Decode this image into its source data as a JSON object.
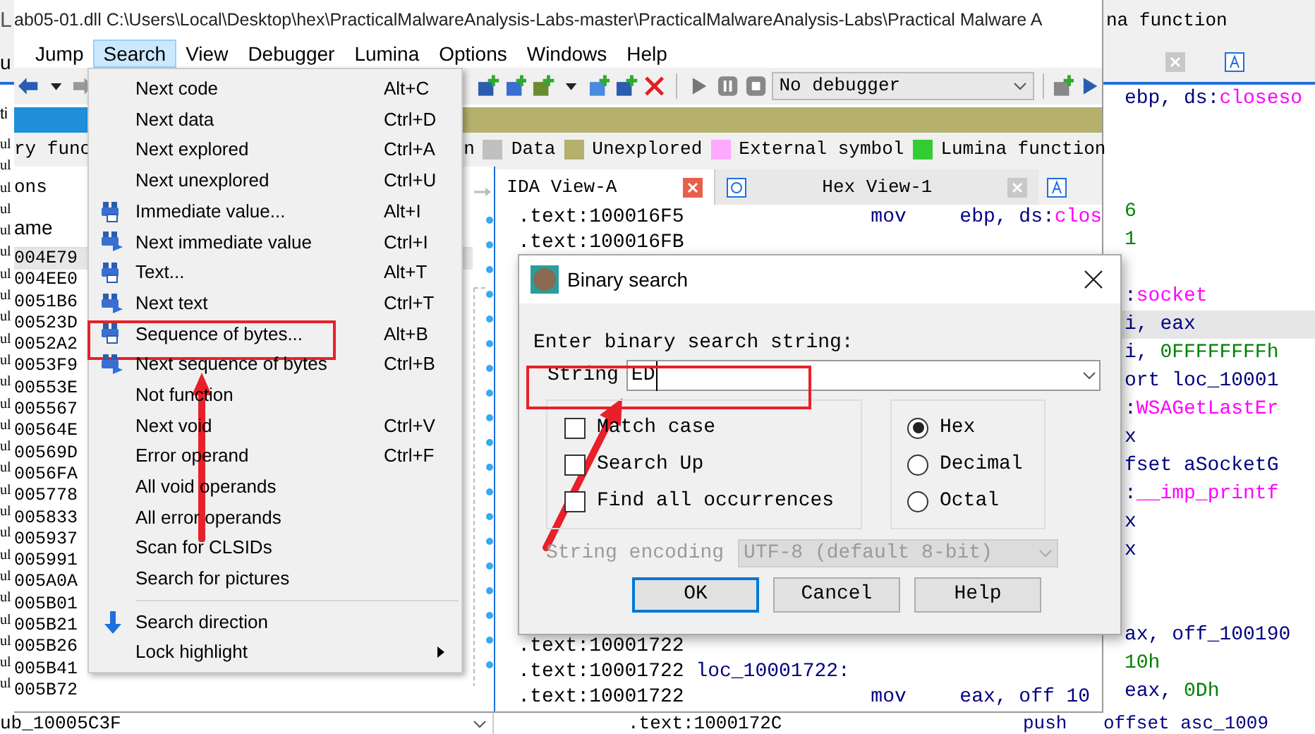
{
  "back_window": {
    "header_fragment": "na function",
    "left_edge": [
      "L",
      "u",
      "ti"
    ],
    "left_edge_rows": [
      "ul",
      "ul",
      "ul",
      "ul",
      "ul",
      "ul",
      "ul",
      "ul",
      "ul",
      "ul",
      "ul",
      "ul",
      "ul",
      "ul",
      "ul",
      "ul",
      "ul",
      "ul",
      "ul",
      "ul",
      "ul",
      "ul",
      "ul",
      "ul",
      "ul",
      "ul"
    ],
    "code_lines": [
      {
        "kind": "code",
        "highlighted": false,
        "segments": [
          {
            "kind": "text",
            "text": "ebp, ds:"
          },
          {
            "kind": "name",
            "text": "closeso"
          }
        ]
      },
      {
        "kind": "blank"
      },
      {
        "kind": "blank"
      },
      {
        "kind": "blank"
      },
      {
        "kind": "code",
        "highlighted": false,
        "segments": [
          {
            "kind": "number",
            "text": "6"
          }
        ]
      },
      {
        "kind": "code",
        "highlighted": false,
        "segments": [
          {
            "kind": "number",
            "text": "1"
          }
        ]
      },
      {
        "kind": "blank"
      },
      {
        "kind": "code",
        "highlighted": false,
        "segments": [
          {
            "kind": "text",
            "text": ":"
          },
          {
            "kind": "name",
            "text": "socket"
          }
        ]
      },
      {
        "kind": "code",
        "highlighted": true,
        "segments": [
          {
            "kind": "text",
            "text": "i, eax"
          }
        ]
      },
      {
        "kind": "code",
        "highlighted": false,
        "segments": [
          {
            "kind": "text",
            "text": "i, "
          },
          {
            "kind": "number",
            "text": "0FFFFFFFFh"
          }
        ]
      },
      {
        "kind": "code",
        "highlighted": false,
        "segments": [
          {
            "kind": "text",
            "text": "ort loc_10001"
          }
        ]
      },
      {
        "kind": "code",
        "highlighted": false,
        "segments": [
          {
            "kind": "text",
            "text": ":"
          },
          {
            "kind": "name",
            "text": "WSAGetLastEr"
          }
        ]
      },
      {
        "kind": "code",
        "highlighted": false,
        "segments": [
          {
            "kind": "text",
            "text": "x"
          }
        ]
      },
      {
        "kind": "code",
        "highlighted": false,
        "segments": [
          {
            "kind": "text",
            "text": "fset aSocketG"
          }
        ]
      },
      {
        "kind": "code",
        "highlighted": false,
        "segments": [
          {
            "kind": "text",
            "text": ":"
          },
          {
            "kind": "name",
            "text": "__imp_printf"
          }
        ]
      },
      {
        "kind": "code",
        "highlighted": false,
        "segments": [
          {
            "kind": "text",
            "text": "x"
          }
        ]
      },
      {
        "kind": "code",
        "highlighted": false,
        "segments": [
          {
            "kind": "text",
            "text": "x"
          }
        ]
      },
      {
        "kind": "blank"
      },
      {
        "kind": "blank"
      },
      {
        "kind": "code",
        "highlighted": false,
        "segments": [
          {
            "kind": "text",
            "text": "ax, off_100190"
          }
        ]
      },
      {
        "kind": "code",
        "highlighted": false,
        "segments": [
          {
            "kind": "number",
            "text": "10h"
          }
        ]
      },
      {
        "kind": "code",
        "highlighted": false,
        "segments": [
          {
            "kind": "text",
            "text": "eax, "
          },
          {
            "kind": "number",
            "text": "0Dh"
          }
        ]
      }
    ],
    "bottom_row": {
      "function_box": "ub_10005C3F",
      "address": ".text:1000172C",
      "mnemonic": "push",
      "operand": "offset asc_1009"
    }
  },
  "window": {
    "title": "ab05-01.dll C:\\Users\\Local\\Desktop\\hex\\PracticalMalwareAnalysis-Labs-master\\PracticalMalwareAnalysis-Labs\\Practical Malware A"
  },
  "menu_bar": [
    {
      "label": "Jump",
      "selected": false
    },
    {
      "label": "Search",
      "selected": true
    },
    {
      "label": "View",
      "selected": false
    },
    {
      "label": "Debugger",
      "selected": false
    },
    {
      "label": "Lumina",
      "selected": false
    },
    {
      "label": "Options",
      "selected": false
    },
    {
      "label": "Windows",
      "selected": false
    },
    {
      "label": "Help",
      "selected": false
    }
  ],
  "toolbar": {
    "debugger_select": "No debugger"
  },
  "legend": {
    "left_fragment": "ry func",
    "right_fragment": "n",
    "items": [
      {
        "label": "Data",
        "color": "#c0c0c0"
      },
      {
        "label": "Unexplored",
        "color": "#b5b06c"
      },
      {
        "label": "External symbol",
        "color": "#ffa8ff"
      },
      {
        "label": "Lumina function",
        "color": "#33cc33"
      }
    ]
  },
  "functions_panel": {
    "title": "ons",
    "column": "ame",
    "rows": [
      {
        "name": "004E79",
        "selected": true
      },
      {
        "name": "004EE0",
        "selected": false
      },
      {
        "name": "0051B6",
        "selected": false
      },
      {
        "name": "00523D",
        "selected": false
      },
      {
        "name": "0052A2",
        "selected": false
      },
      {
        "name": "0053F9",
        "selected": false
      },
      {
        "name": "00553E",
        "selected": false
      },
      {
        "name": "005567",
        "selected": false
      },
      {
        "name": "00564E",
        "selected": false
      },
      {
        "name": "00569D",
        "selected": false
      },
      {
        "name": "0056FA",
        "selected": false
      },
      {
        "name": "005778",
        "selected": false
      },
      {
        "name": "005833",
        "selected": false
      },
      {
        "name": "005937",
        "selected": false
      },
      {
        "name": "005991",
        "selected": false
      },
      {
        "name": "005A0A",
        "selected": false
      },
      {
        "name": "005B01",
        "selected": false
      },
      {
        "name": "005B21",
        "selected": false
      },
      {
        "name": "005B26",
        "selected": false
      },
      {
        "name": "005B41",
        "selected": false
      },
      {
        "name": "005B72",
        "selected": false
      }
    ]
  },
  "view_tabs": [
    {
      "label": "IDA View-A",
      "selected": true
    },
    {
      "label": "Hex View-1",
      "selected": false
    }
  ],
  "code_top": [
    {
      "address": ".text:100016F5",
      "mnemonic": "mov",
      "operand": [
        {
          "kind": "text",
          "text": "ebp, ds:"
        },
        {
          "kind": "name",
          "text": "clos"
        }
      ]
    },
    {
      "address": ".text:100016FB"
    }
  ],
  "code_bottom": [
    {
      "address": ".text:10001722"
    },
    {
      "address": ".text:10001722",
      "label": "loc_10001722:"
    },
    {
      "address": ".text:10001722",
      "mnemonic": "mov",
      "operand": [
        {
          "kind": "text",
          "text": "eax, off 10"
        }
      ]
    }
  ],
  "search_menu": [
    {
      "kind": "plain",
      "label": "Next code",
      "shortcut": "Alt+C"
    },
    {
      "kind": "plain",
      "label": "Next data",
      "shortcut": "Ctrl+D"
    },
    {
      "kind": "plain",
      "label": "Next explored",
      "shortcut": "Ctrl+A"
    },
    {
      "kind": "plain",
      "label": "Next unexplored",
      "shortcut": "Ctrl+U"
    },
    {
      "kind": "find",
      "label": "Immediate value...",
      "shortcut": "Alt+I"
    },
    {
      "kind": "find-next",
      "label": "Next immediate value",
      "shortcut": "Ctrl+I"
    },
    {
      "kind": "find",
      "label": "Text...",
      "shortcut": "Alt+T"
    },
    {
      "kind": "find-next",
      "label": "Next text",
      "shortcut": "Ctrl+T"
    },
    {
      "kind": "find",
      "label": "Sequence of bytes...",
      "shortcut": "Alt+B"
    },
    {
      "kind": "find-next",
      "label": "Next sequence of bytes",
      "shortcut": "Ctrl+B"
    },
    {
      "kind": "plain",
      "label": "Not function"
    },
    {
      "kind": "plain",
      "label": "Next void",
      "shortcut": "Ctrl+V"
    },
    {
      "kind": "plain",
      "label": "Error operand",
      "shortcut": "Ctrl+F"
    },
    {
      "kind": "plain",
      "label": "All void operands"
    },
    {
      "kind": "plain",
      "label": "All error operands"
    },
    {
      "kind": "plain",
      "label": "Scan for CLSIDs"
    },
    {
      "kind": "plain",
      "label": "Search for pictures"
    },
    {
      "kind": "separator"
    },
    {
      "kind": "direction",
      "label": "Search direction"
    },
    {
      "kind": "submenu",
      "label": "Lock highlight"
    }
  ],
  "dialog": {
    "title": "Binary search",
    "prompt": "Enter binary search string:",
    "string_label": "String",
    "string_value": "ED",
    "options": [
      {
        "label": "Match case",
        "checked": false
      },
      {
        "label": "Search Up",
        "checked": false
      },
      {
        "label": "Find all occurrences",
        "checked": false
      }
    ],
    "radix": [
      {
        "label": "Hex",
        "selected": true
      },
      {
        "label": "Decimal",
        "selected": false
      },
      {
        "label": "Octal",
        "selected": false
      }
    ],
    "encoding_label": "String encoding",
    "encoding_value": "UTF-8 (default 8-bit)",
    "encoding_disabled": true,
    "buttons": [
      {
        "label": "OK",
        "focused": true
      },
      {
        "label": "Cancel",
        "focused": false
      },
      {
        "label": "Help",
        "focused": false
      }
    ]
  }
}
